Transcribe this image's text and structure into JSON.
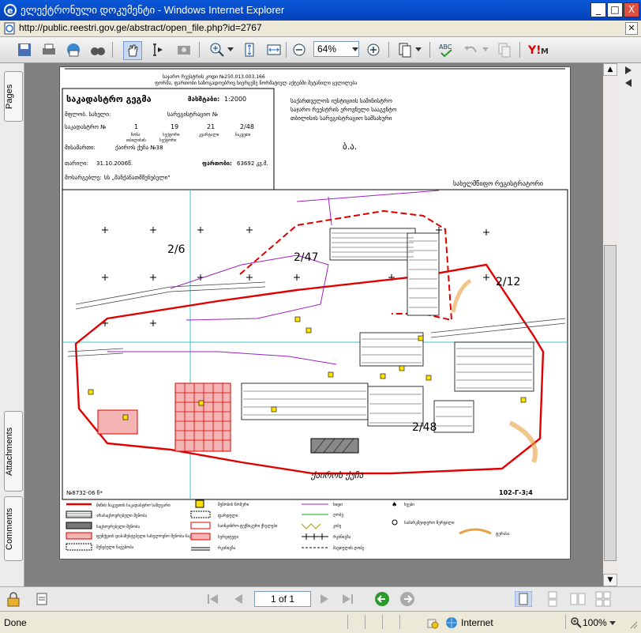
{
  "window": {
    "title": "ელექტრონული დოკუმენტი - Windows Internet Explorer",
    "minimize": "_",
    "maximize": "□",
    "close": "X"
  },
  "address": {
    "url": "http://public.reestri.gov.ge/abstract/open_file.php?id=2767",
    "close": "✕"
  },
  "toolbar": {
    "zoom": "64%"
  },
  "sidebar": {
    "tabs": [
      "Pages",
      "Attachments",
      "Comments"
    ]
  },
  "document": {
    "header_line1": "საჯარო რეესტრის კოდი №250.013.003.166",
    "header_line2": "ფორმა, ფართობი საზოგადოებრივ სივრცეზე ნორმატიულ აქტებში შეტანილი ცვლილება",
    "title": "საკადასტრო გეგმა",
    "scale_label": "მასშტაბი:",
    "scale_value": "1:2000",
    "owner_label": "მფლობ. სახელი:",
    "registry_label": "სარეგისტრაციო №",
    "cadastral_label": "საკადასტრო №",
    "cadastral_codes": [
      "1",
      "19",
      "21",
      "2/48"
    ],
    "cadastral_sub": [
      "ზონა",
      "სექტორი",
      "კვარტალი",
      "ნაკვეთი"
    ],
    "cadastral_sub2": [
      "თბილისის",
      "სექტორი"
    ],
    "address_label": "მისამართი:",
    "address_value": "ქაიროს ქუჩა №38",
    "date_label": "თარიღი:",
    "date_value": "31.10.2006წ.",
    "area_label": "ფართობი:",
    "area_value": "63692 კვ.მ.",
    "owner2_label": "მოსარგებლე:",
    "owner2_value": "სს „მანქანათმშენებელი“",
    "agency": [
      "საქართველოს იუსტიციის სამინისტრო",
      "საჯარო რეესტრის ეროვნული სააგენტო",
      "თბილისის სარეგისტრაციო სამსახური"
    ],
    "seal": "ბ.ა.",
    "registrar": "სახელმწიფო რეგისტრატორი",
    "plots": [
      "2/6",
      "2/47",
      "2/12",
      "2/48"
    ],
    "street": "ქაიროს ქუჩა",
    "map_code_left": "№8732-06 წ*",
    "map_code_right": "102-Г-3;4",
    "legend": [
      "მიწის ნაკვეთის საკადასტრო საზღვარი",
      "არასაცხოვრებელი შენობა",
      "საცხოვრებელი შენობა",
      "ფუნქციის დასაზუსტებელი სახელოვნო შენობა-ნაგებობა",
      "შენებული ნაგებობა",
      "შენობის ნომერი",
      "ფარდული",
      "საინჟინრო-ტექნიკური ქსელები",
      "სერვიტუტი",
      "რკინიგზა",
      "ხიდი",
      "ღობე",
      "კიბე",
      "რკინიგზა",
      "მავთულის ღობე",
      "ხეები",
      "სამარკშეიდერო წერტილი",
      "ტერასა"
    ]
  },
  "nav": {
    "page": "1 of 1"
  },
  "status": {
    "left": "Done",
    "zone": "Internet",
    "zoom": "100%"
  }
}
